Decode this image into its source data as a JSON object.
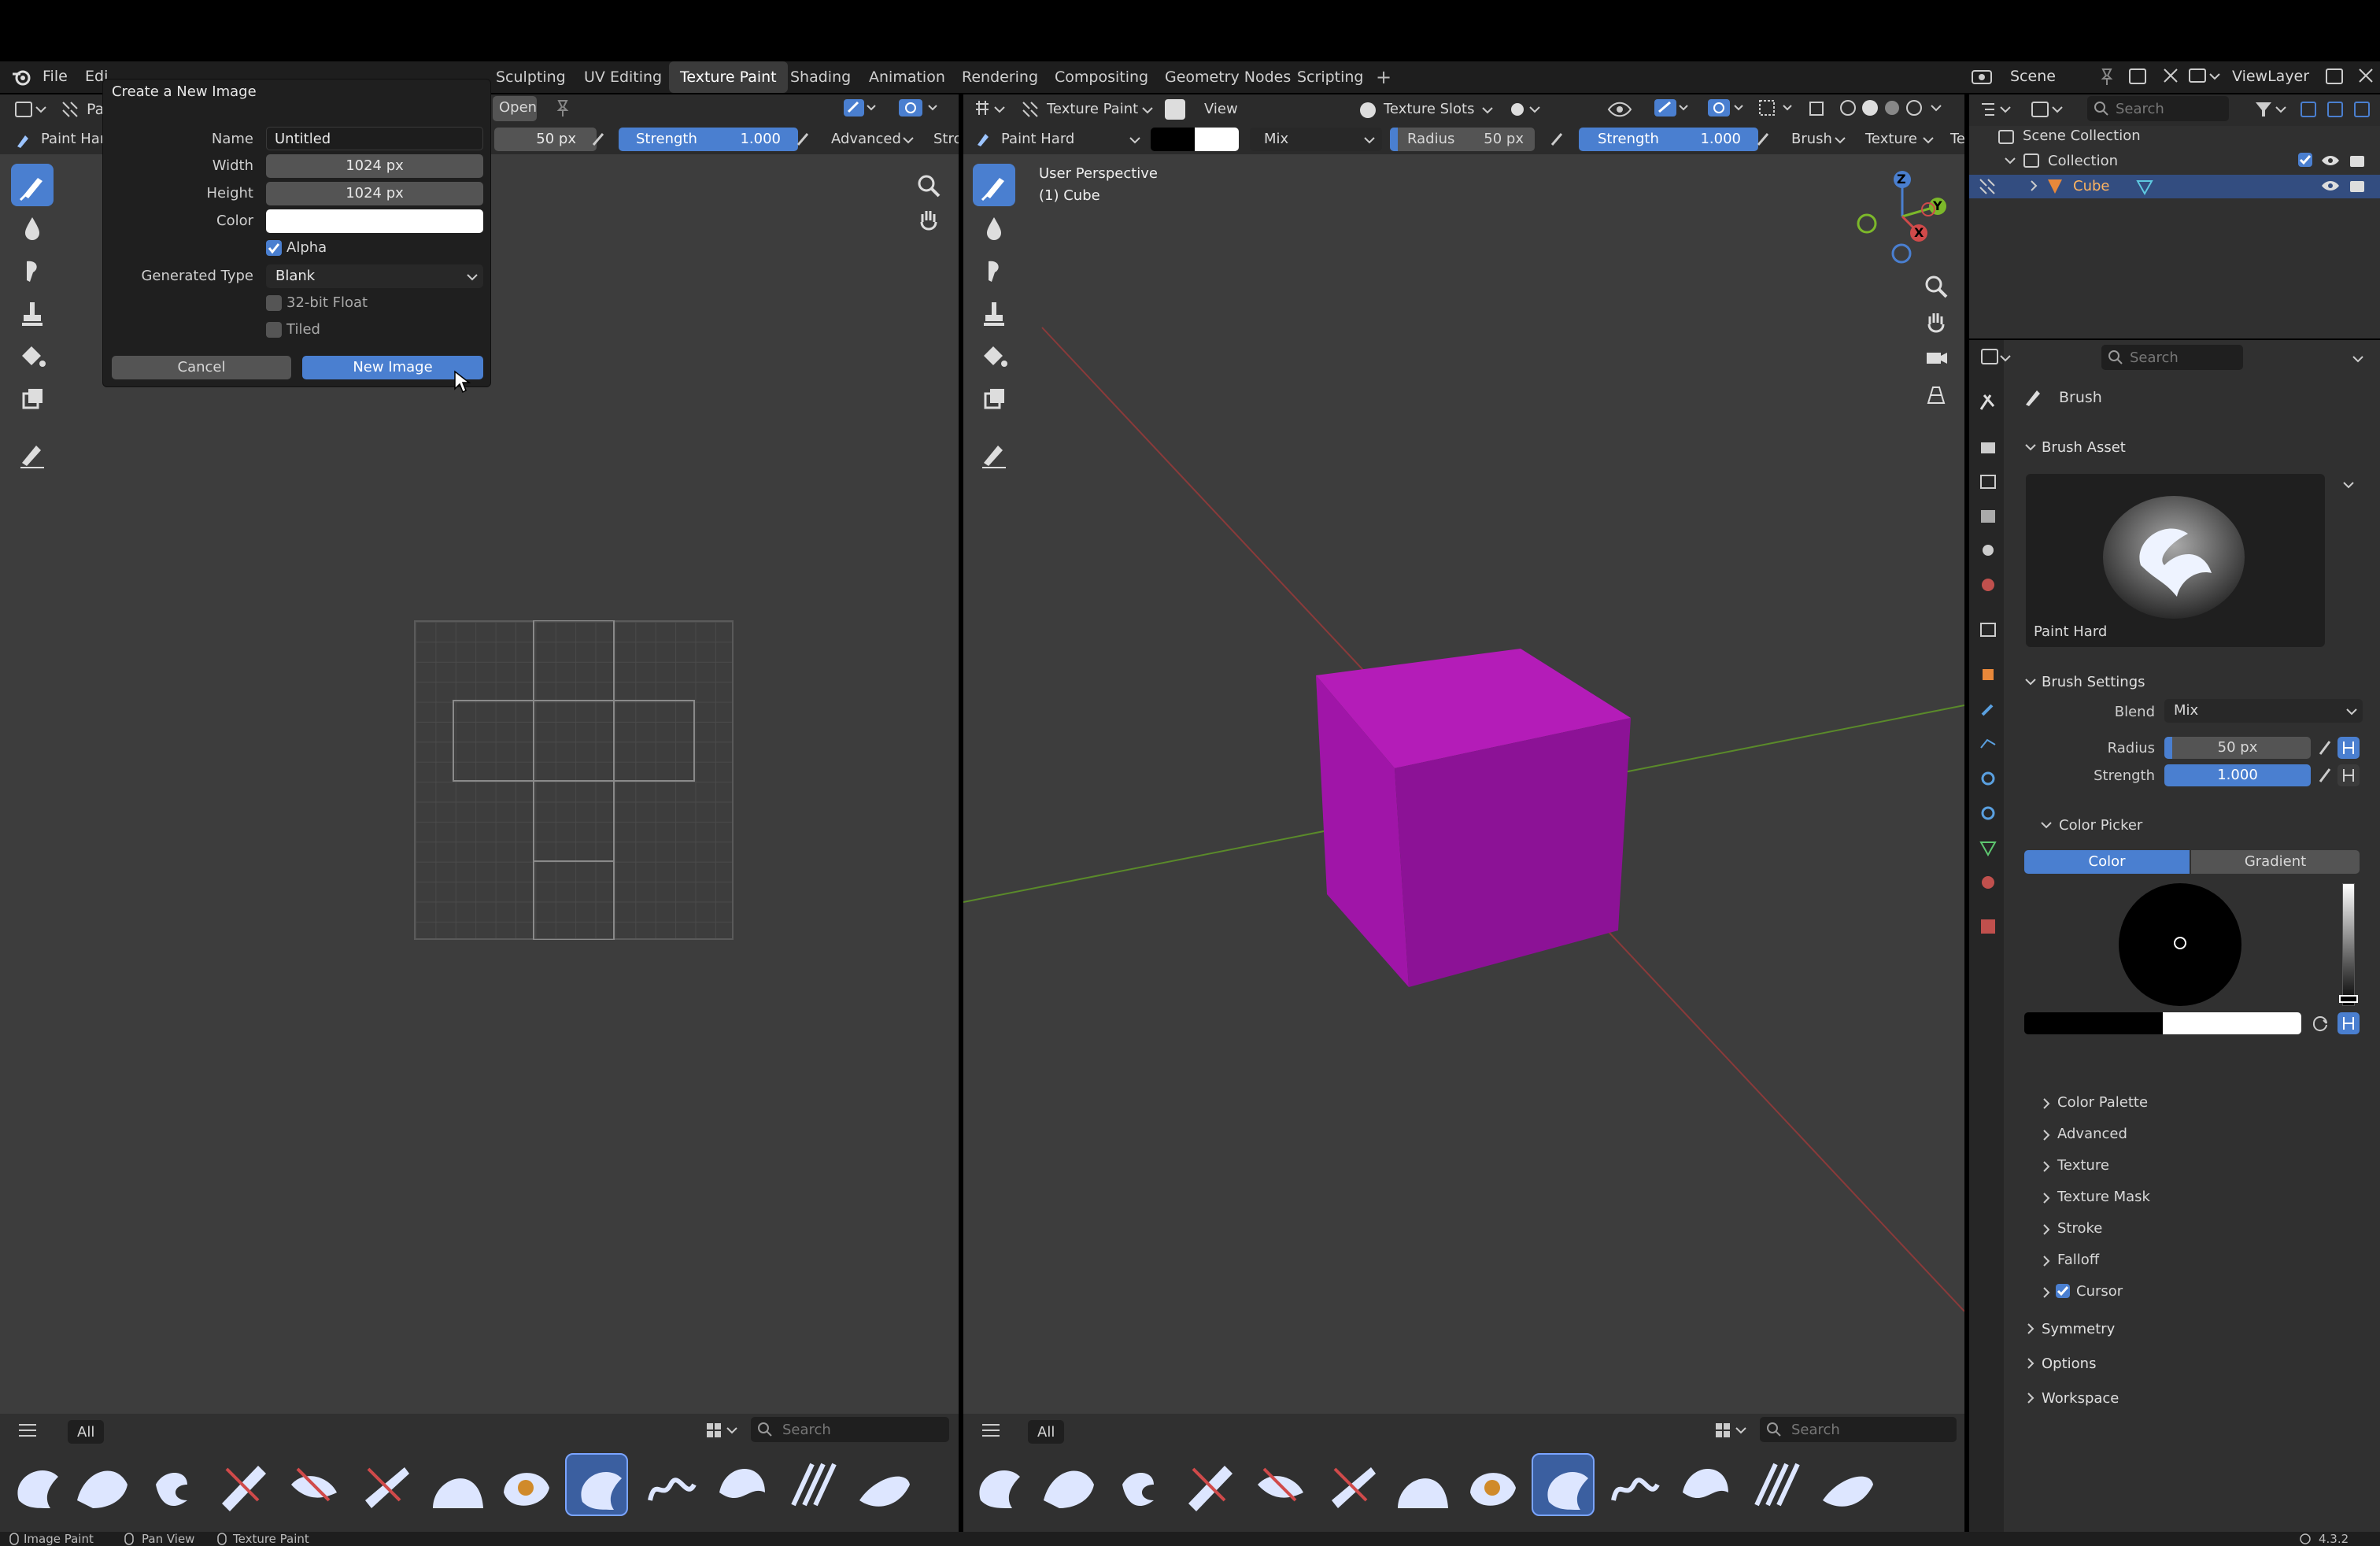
{
  "menu": {
    "file": "File",
    "edit": "Edi",
    "tabs": [
      "Sculpting",
      "UV Editing",
      "Texture Paint",
      "Shading",
      "Animation",
      "Rendering",
      "Compositing",
      "Geometry Nodes",
      "Scripting"
    ],
    "plus": "+",
    "scene": "Scene",
    "viewlayer": "ViewLayer"
  },
  "left_header": {
    "open_label": "Open",
    "brush_short": "Paint Har",
    "radius_value": "50 px",
    "strength_label": "Strength",
    "strength_value": "1.000",
    "advanced": "Advanced",
    "stroke_short": "Stro",
    "title_short": "Pa"
  },
  "dialog": {
    "title": "Create a New Image",
    "name_label": "Name",
    "name_value": "Untitled",
    "width_label": "Width",
    "width_value": "1024 px",
    "height_label": "Height",
    "height_value": "1024 px",
    "color_label": "Color",
    "alpha_label": "Alpha",
    "generated_type_label": "Generated Type",
    "generated_type_value": "Blank",
    "float_label": "32-bit Float",
    "tiled_label": "Tiled",
    "cancel_label": "Cancel",
    "ok_label": "New Image"
  },
  "viewport_header": {
    "mode": "Texture Paint",
    "view": "View",
    "texture_slots": "Texture Slots",
    "brush": "Paint Hard",
    "blend": "Mix",
    "radius_label": "Radius",
    "radius_value": "50 px",
    "strength_label": "Strength",
    "strength_value": "1.000",
    "brush_menu": "Brush",
    "texture_menu": "Texture",
    "te_short": "Te"
  },
  "viewport": {
    "perspective": "User Perspective",
    "object": "(1) Cube",
    "axis_z": "Z",
    "axis_y": "Y",
    "axis_x": "X"
  },
  "outliner": {
    "search_placeholder": "Search",
    "scene_collection": "Scene Collection",
    "collection": "Collection",
    "cube": "Cube"
  },
  "properties": {
    "search_placeholder": "Search",
    "brush_title": "Brush",
    "brush_asset": "Brush Asset",
    "brush_name": "Paint Hard",
    "brush_settings": "Brush Settings",
    "blend_label": "Blend",
    "blend_value": "Mix",
    "radius_label": "Radius",
    "radius_value": "50 px",
    "strength_label": "Strength",
    "strength_value": "1.000",
    "color_picker": "Color Picker",
    "color_tab": "Color",
    "gradient_tab": "Gradient",
    "subpanels": [
      "Color Palette",
      "Advanced",
      "Texture",
      "Texture Mask",
      "Stroke",
      "Falloff",
      "Cursor"
    ],
    "sections": [
      "Symmetry",
      "Options",
      "Workspace"
    ]
  },
  "asset_shelf": {
    "all_label": "All",
    "search_placeholder": "Search"
  },
  "status": {
    "items": [
      "Image Paint",
      "Pan View",
      "Texture Paint"
    ],
    "version": "4.3.2"
  },
  "colors": {
    "accent": "#4a7fd0",
    "cube": "#a015a8",
    "bg": "#3d3d3d",
    "panel": "#303030",
    "header": "#2b2b2b"
  }
}
